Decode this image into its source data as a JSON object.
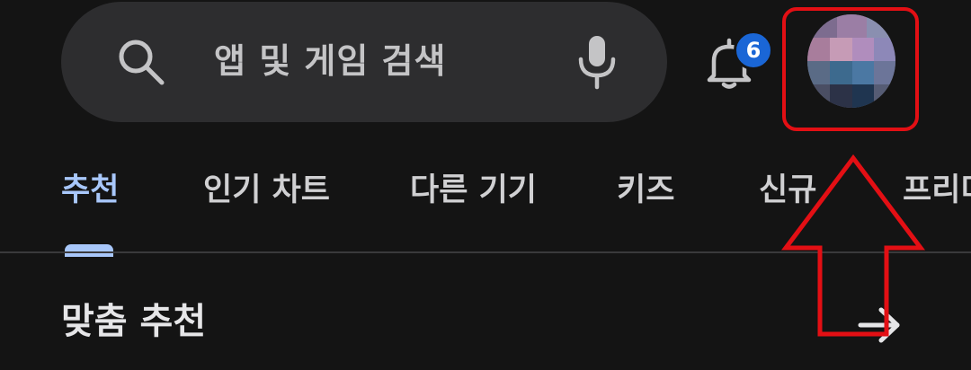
{
  "search": {
    "placeholder": "앱 및 게임 검색"
  },
  "notifications": {
    "count": "6"
  },
  "tabs": [
    {
      "label": "추천",
      "active": true
    },
    {
      "label": "인기 차트",
      "active": false
    },
    {
      "label": "다른 기기",
      "active": false
    },
    {
      "label": "키즈",
      "active": false
    },
    {
      "label": "신규",
      "active": false
    },
    {
      "label": "프리미",
      "active": false
    }
  ],
  "section": {
    "title": "맞춤 추천"
  },
  "colors": {
    "background": "#141414",
    "search_bar": "#2d2d2f",
    "accent": "#a8c7fa",
    "badge": "#1a66d6",
    "annotation": "#e30f14"
  },
  "icons": {
    "search": "search-icon",
    "mic": "mic-icon",
    "bell": "bell-icon",
    "arrow": "arrow-right-icon"
  }
}
